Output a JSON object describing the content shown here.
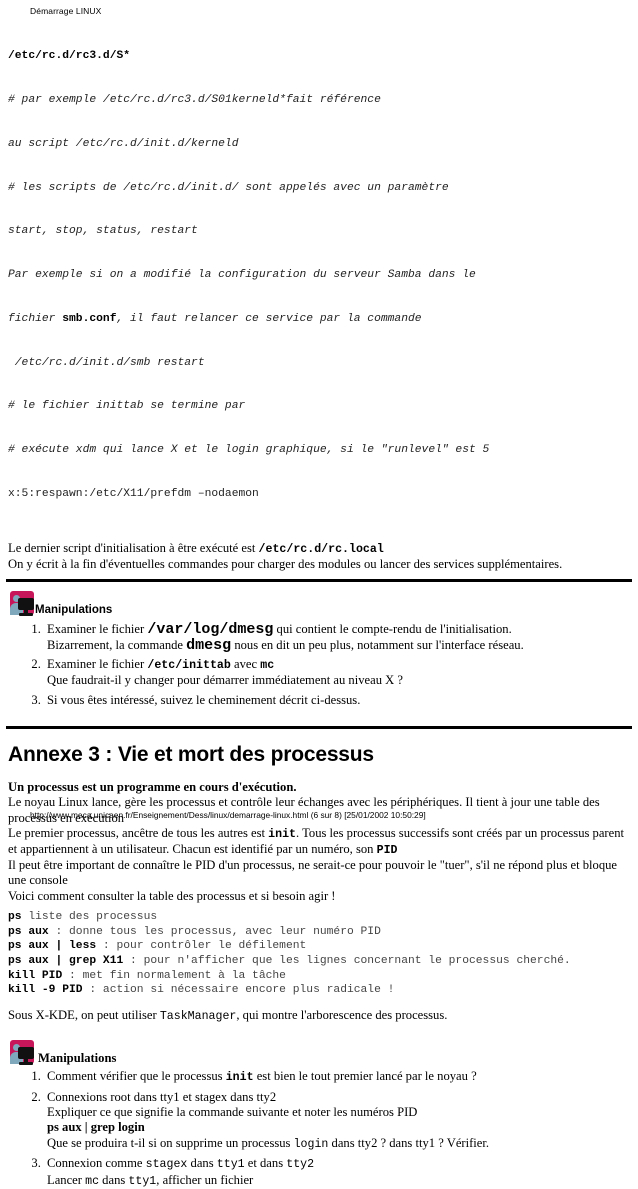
{
  "document": {
    "running_head": "Démarrage LINUX",
    "footer": "http://www.meca.unicaen.fr/Enseignement/Dess/linux/demarrage-linux.html (6 sur 8) [25/01/2002 10:50:29]"
  },
  "colors": {
    "icon_background": "#c8165a",
    "icon_person": "#7fa8bd",
    "icon_monitor": "#111111",
    "rule": "#000000",
    "code_text": "#444444"
  },
  "code_block": {
    "title": "/etc/rc.d/rc3.d/S*",
    "lines": [
      "# par exemple /etc/rc.d/rc3.d/S01kerneld*fait référence",
      "au script /etc/rc.d/init.d/kerneld",
      "# les scripts de /etc/rc.d/init.d/ sont appelés avec un paramètre",
      "start, stop, status, restart",
      "Par exemple si on a modifié la configuration du serveur Samba dans le",
      "fichier ",
      "smb.conf",
      ", il faut relancer ce service par la commande",
      " /etc/rc.d/init.d/smb restart",
      "# le fichier inittab se termine par",
      "# exécute xdm qui lance X et le login graphique, si le \"runlevel\" est 5",
      "x:5:respawn:/etc/X11/prefdm –nodaemon"
    ]
  },
  "rc_local": {
    "line1_prefix": "Le dernier script d'initialisation à être exécuté est ",
    "line1_code": "/etc/rc.d/rc.local",
    "line2": "On y écrit à la fin d'éventuelles commandes pour charger des modules ou lancer des services supplémentaires."
  },
  "manipulations_1": {
    "label": "Manipulations",
    "icon": "person-computer-icon",
    "items": [
      {
        "main_prefix": "Examiner le fichier ",
        "main_code": "/var/log/dmesg",
        "main_suffix": " qui contient le compte-rendu de l'initialisation.",
        "sub_prefix": "Bizarrement, la commande  ",
        "sub_code": "dmesg",
        "sub_suffix": "  nous en dit un peu plus, notamment sur l'interface réseau."
      },
      {
        "main_prefix": "Examiner le fichier ",
        "main_code": "/etc/inittab",
        "main_mid": " avec ",
        "main_code2": "mc",
        "main_suffix": "",
        "sub": "Que faudrait-il y changer pour démarrer immédiatement au niveau X ?"
      },
      {
        "main": "Si vous êtes intéressé, suivez le cheminement décrit ci-dessus."
      }
    ]
  },
  "annexe": {
    "title": "Annexe 3 : Vie et mort des processus",
    "intro_bold": "Un processus est un programme en cours d'exécution.",
    "paragraphs": [
      "Le noyau Linux lance, gère les processus et contrôle leur échanges avec les périphériques. Il tient à jour une table des processus en exécution",
      "Il peut être important de connaître le PID d'un processus, ne serait-ce pour pouvoir le \"tuer\", s'il ne répond plus et bloque une console",
      "Voici comment consulter la table des processus et si besoin agir !"
    ],
    "init_line": {
      "prefix": "Le premier processus, ancêtre de tous les autres est ",
      "code": "init",
      "mid": ". Tous les processus successifs sont créés par un processus parent et appartiennent à un utilisateur. Chacun est identifié par un numéro, son ",
      "code2": "PID"
    },
    "commands": [
      {
        "cmd": "ps",
        "rest": " liste des processus"
      },
      {
        "cmd": "ps aux",
        "rest": " : donne tous les processus, avec leur numéro PID"
      },
      {
        "cmd": "ps aux | less",
        "rest": " : pour contrôler le défilement"
      },
      {
        "cmd": "ps aux | grep X11",
        "rest": " : pour n'afficher que les lignes concernant le processus cherché."
      },
      {
        "cmd": "kill PID",
        "rest": " : met fin normalement à la tâche"
      },
      {
        "cmd": "kill -9 PID",
        "rest": " : action si nécessaire encore plus radicale !"
      }
    ],
    "kde_line": {
      "prefix": "Sous X-KDE, on peut utiliser ",
      "code": "TaskManager",
      "suffix": ", qui montre l'arborescence des processus."
    }
  },
  "manipulations_2": {
    "label": "Manipulations",
    "icon": "person-computer-icon",
    "items": [
      {
        "main_prefix": "Comment vérifier que le processus ",
        "main_code": "init",
        "main_suffix": " est bien le tout premier lancé par le noyau ?"
      },
      {
        "main": "Connexions root dans tty1 et stagex dans tty2",
        "sub1": "Expliquer ce que signifie la commande suivante et noter les numéros PID",
        "sub2_bold": "ps aux | grep login",
        "sub3_prefix": "Que se produira t-il si on supprime un processus ",
        "sub3_code": "login",
        "sub3_suffix": " dans tty2 ? dans tty1 ? Vérifier."
      },
      {
        "main_prefix": "Connexion comme ",
        "main_code": "stagex",
        "main_mid": " dans ",
        "main_code2": "tty1",
        "main_mid2": " et dans ",
        "main_code3": "tty2",
        "sub_prefix": "Lancer ",
        "sub_code": "mc",
        "sub_mid": " dans ",
        "sub_code2": "tty1",
        "sub_suffix": ", afficher un fichier"
      }
    ]
  }
}
